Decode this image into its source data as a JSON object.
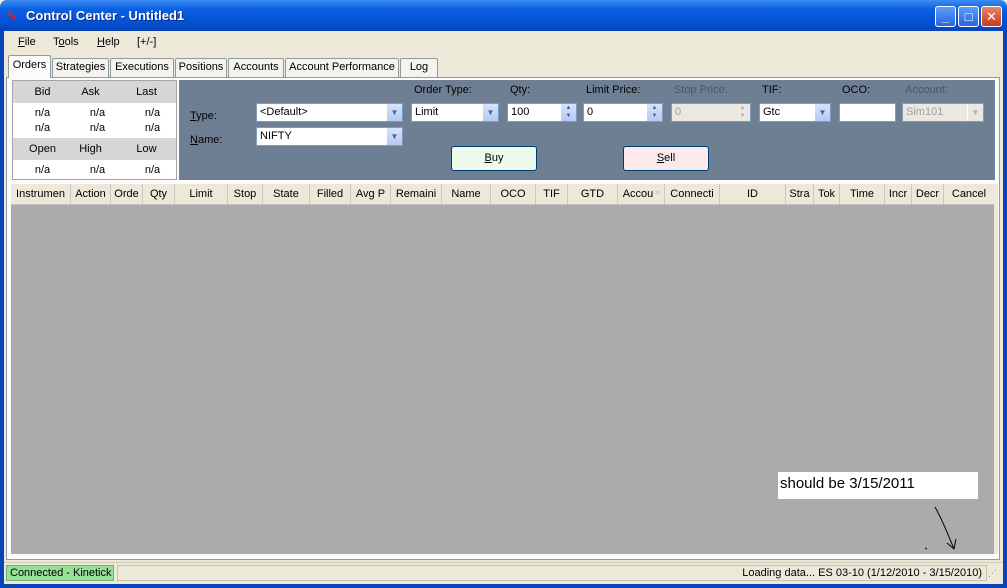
{
  "window": {
    "title": "Control Center - Untitled1",
    "app_icon": "ninja-logo-icon",
    "buttons": {
      "minimize": "_",
      "maximize": "□",
      "close": "✕"
    }
  },
  "menu": {
    "items": [
      {
        "label_u": "F",
        "label_rest": "ile"
      },
      {
        "label_pre": "T",
        "label_u": "o",
        "label_rest": "ols"
      },
      {
        "label_u": "H",
        "label_rest": "elp"
      },
      {
        "label": "[+/-]"
      }
    ]
  },
  "tabs": [
    "Orders",
    "Strategies",
    "Executions",
    "Positions",
    "Accounts",
    "Account Performance",
    "Log"
  ],
  "quote": {
    "row1_headers": [
      "Bid",
      "Ask",
      "Last"
    ],
    "row1_values_a": [
      "n/a",
      "n/a",
      "n/a"
    ],
    "row1_values_b": [
      "n/a",
      "n/a",
      "n/a"
    ],
    "row2_headers": [
      "Open",
      "High",
      "Low"
    ],
    "row2_values": [
      "n/a",
      "n/a",
      "n/a"
    ]
  },
  "order_entry": {
    "type_label_u": "T",
    "type_label_rest": "ype:",
    "type_value": "<Default>",
    "name_label_u": "N",
    "name_label_rest": "ame:",
    "name_value": "NIFTY",
    "order_type_label": "Order Type:",
    "order_type_value": "Limit",
    "qty_label": "Qty:",
    "qty_value": "100",
    "limit_price_label": "Limit Price:",
    "limit_price_value": "0",
    "stop_price_label": "Stop Price:",
    "stop_price_value": "0",
    "tif_label": "TIF:",
    "tif_value": "Gtc",
    "oco_label": "OCO:",
    "oco_value": "",
    "account_label": "Account:",
    "account_value": "Sim101",
    "buy_label_u": "B",
    "buy_label_rest": "uy",
    "sell_label_u": "S",
    "sell_label_rest": "ell",
    "colors": {
      "buy_bg": "#EEFAEE",
      "sell_bg": "#FCEAEA",
      "panel_bg": "#6E7F94"
    }
  },
  "grid": {
    "columns": [
      "Instrumen",
      "Action",
      "Orde",
      "Qty",
      "Limit",
      "Stop",
      "State",
      "Filled",
      "Avg P",
      "Remaini",
      "Name",
      "OCO",
      "TIF",
      "GTD",
      "Accou",
      "Connecti",
      "ID",
      "Stra",
      "Tok",
      "Time",
      "Incr",
      "Decr",
      "Cancel"
    ]
  },
  "annotation": {
    "text": "should be 3/15/2011"
  },
  "status": {
    "connection": "Connected - Kinetick",
    "message": "Loading data... ES 03-10  (1/12/2010 - 3/15/2010)"
  }
}
